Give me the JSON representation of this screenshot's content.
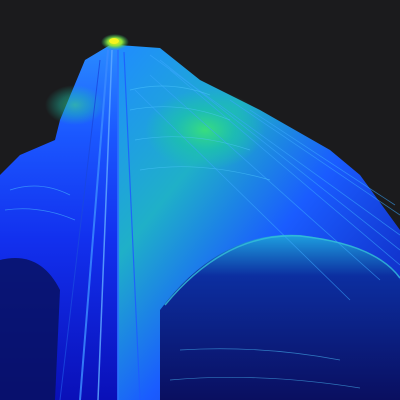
{
  "image": {
    "kind": "lidar-point-cloud-render",
    "colormap": [
      "#0a12c8",
      "#1638ff",
      "#1f7aff",
      "#19c2c0",
      "#28d67a",
      "#9be83a",
      "#f4f21a"
    ],
    "background_color": "#1b1b1d"
  }
}
